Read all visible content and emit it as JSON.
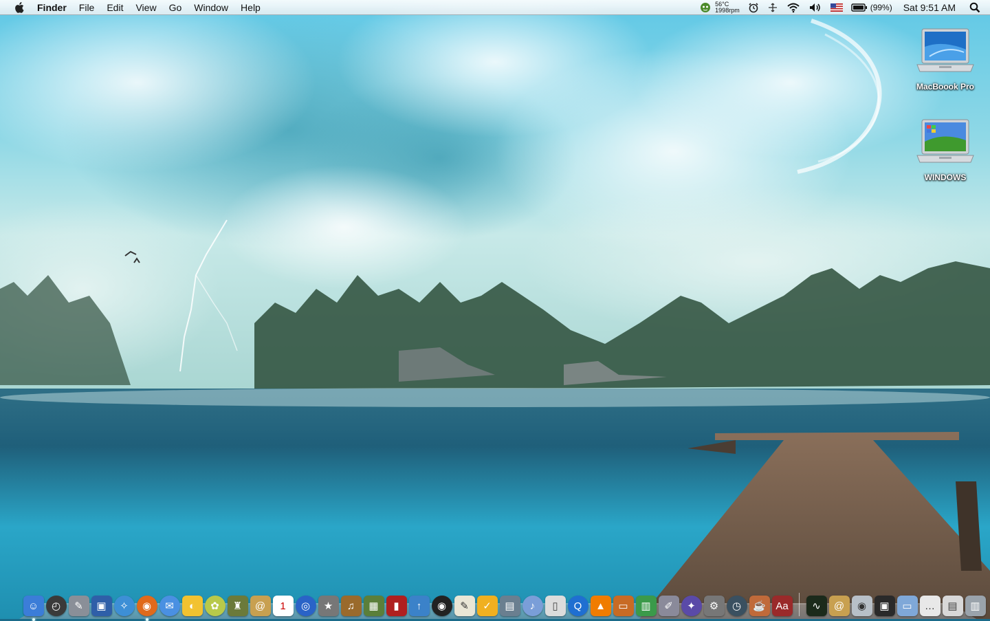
{
  "menubar": {
    "app_name": "Finder",
    "menus": [
      "File",
      "Edit",
      "View",
      "Go",
      "Window",
      "Help"
    ],
    "temperature": "56°C",
    "fan_speed": "1998rpm",
    "battery_percent": "(99%)",
    "clock": "Sat 9:51 AM"
  },
  "desktop": {
    "icons": [
      {
        "label": "MacBoook Pro",
        "icon": "laptop-drive-icon"
      },
      {
        "label": "WINDOWS",
        "icon": "windows-drive-icon"
      }
    ]
  },
  "dock": {
    "apps": [
      {
        "name": "finder-dock-icon",
        "color": "#3b7dd8",
        "glyph": "☺",
        "running": true
      },
      {
        "name": "dashboard-dock-icon",
        "color": "#3a3a3a",
        "glyph": "◴",
        "round": true
      },
      {
        "name": "automator-dock-icon",
        "color": "#8a8f98",
        "glyph": "✎"
      },
      {
        "name": "preview-dock-icon",
        "color": "#2f5fa8",
        "glyph": "▣"
      },
      {
        "name": "safari-dock-icon",
        "color": "#3d8fd6",
        "glyph": "✧",
        "round": true
      },
      {
        "name": "firefox-dock-icon",
        "color": "#e06a1b",
        "glyph": "◉",
        "round": true,
        "running": true
      },
      {
        "name": "ichat-dock-icon",
        "color": "#4a90e2",
        "glyph": "✉",
        "round": true
      },
      {
        "name": "adium-dock-icon",
        "color": "#f2c230",
        "glyph": "◐"
      },
      {
        "name": "mail-alt-dock-icon",
        "color": "#b8c94a",
        "glyph": "✿",
        "round": true
      },
      {
        "name": "robot-dock-icon",
        "color": "#6b7a3a",
        "glyph": "♜"
      },
      {
        "name": "address-book-dock-icon",
        "color": "#c8a050",
        "glyph": "@"
      },
      {
        "name": "ical-dock-icon",
        "color": "#ffffff",
        "glyph": "1",
        "text_color": "#c00"
      },
      {
        "name": "dvd-dock-icon",
        "color": "#2a63c7",
        "glyph": "◎",
        "round": true
      },
      {
        "name": "imovie-star-dock-icon",
        "color": "#777777",
        "glyph": "★"
      },
      {
        "name": "garageband-dock-icon",
        "color": "#9a6a2c",
        "glyph": "♫"
      },
      {
        "name": "iphoto-dock-icon",
        "color": "#5b7f3a",
        "glyph": "▦"
      },
      {
        "name": "photo-booth-dock-icon",
        "color": "#b02020",
        "glyph": "▮"
      },
      {
        "name": "flickr-uploader-dock-icon",
        "color": "#3b82c9",
        "glyph": "↑"
      },
      {
        "name": "aperture-dock-icon",
        "color": "#222222",
        "glyph": "◉",
        "round": true
      },
      {
        "name": "textedit-dock-icon",
        "color": "#e9e6d6",
        "glyph": "✎",
        "text_color": "#333"
      },
      {
        "name": "pages-dock-icon",
        "color": "#f0b020",
        "glyph": "✓"
      },
      {
        "name": "keynote-dock-icon",
        "color": "#6a7f90",
        "glyph": "▤"
      },
      {
        "name": "itunes-dock-icon",
        "color": "#7a9ed8",
        "glyph": "♪",
        "round": true
      },
      {
        "name": "ipod-dock-icon",
        "color": "#dcdcdc",
        "glyph": "▯",
        "text_color": "#444"
      },
      {
        "name": "quicktime-dock-icon",
        "color": "#1f6fd1",
        "glyph": "Q",
        "round": true
      },
      {
        "name": "vlc-dock-icon",
        "color": "#f07c00",
        "glyph": "▲"
      },
      {
        "name": "presentation-dock-icon",
        "color": "#c86b25",
        "glyph": "▭"
      },
      {
        "name": "numbers-dock-icon",
        "color": "#3b9a4a",
        "glyph": "▥"
      },
      {
        "name": "script-editor-dock-icon",
        "color": "#8a8a9a",
        "glyph": "✐"
      },
      {
        "name": "directory-utility-dock-icon",
        "color": "#5a4aa8",
        "glyph": "✦",
        "round": true
      },
      {
        "name": "system-preferences-dock-icon",
        "color": "#777777",
        "glyph": "⚙"
      },
      {
        "name": "time-machine-dock-icon",
        "color": "#3a5060",
        "glyph": "◷",
        "round": true
      },
      {
        "name": "coffee-dock-icon",
        "color": "#c06a3a",
        "glyph": "☕"
      },
      {
        "name": "dictionary-dock-icon",
        "color": "#9a2a2a",
        "glyph": "Aa"
      }
    ],
    "stacks": [
      {
        "name": "activity-monitor-dock-icon",
        "color": "#1b2a1b",
        "glyph": "∿"
      },
      {
        "name": "address-book-stack-dock-icon",
        "color": "#c8a050",
        "glyph": "@"
      },
      {
        "name": "disk-utility-dock-icon",
        "color": "#b8c0c8",
        "glyph": "◉",
        "text_color": "#333"
      },
      {
        "name": "photo-stack-dock-icon",
        "color": "#2a2a2a",
        "glyph": "▣"
      },
      {
        "name": "applications-folder-dock-icon",
        "color": "#7fa8d8",
        "glyph": "▭"
      },
      {
        "name": "documents-stack-dock-icon",
        "color": "#e8e8e8",
        "glyph": "…",
        "text_color": "#333"
      },
      {
        "name": "downloads-stack-dock-icon",
        "color": "#d8d8d8",
        "glyph": "▤",
        "text_color": "#444"
      },
      {
        "name": "trash-dock-icon",
        "color": "#9aa3ab",
        "glyph": "▥"
      }
    ]
  }
}
